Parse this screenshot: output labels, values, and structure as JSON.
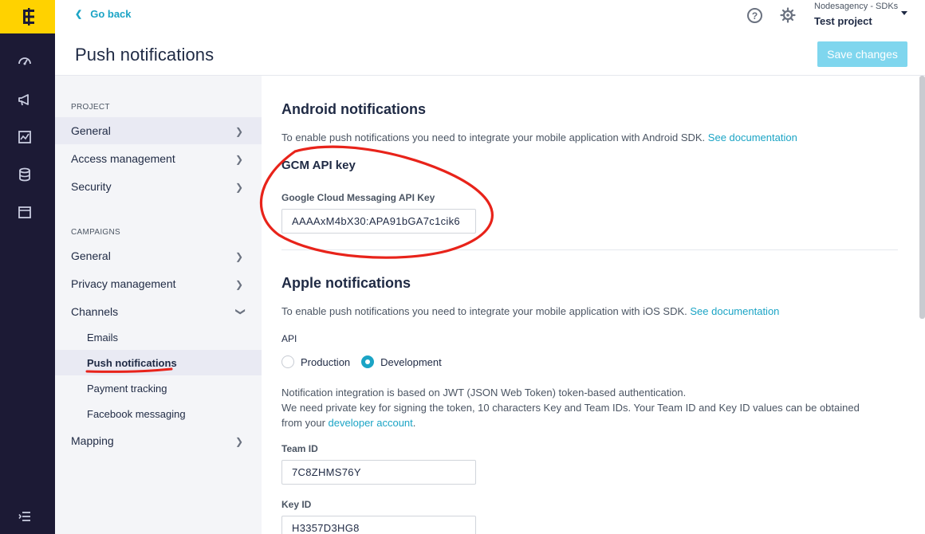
{
  "header": {
    "go_back": "Go back",
    "title": "Push notifications",
    "org_name": "Nodesagency - SDKs",
    "project_name": "Test project",
    "save_label": "Save changes"
  },
  "rail": {
    "logo": "Ɇ",
    "icons": [
      "dashboard-icon",
      "megaphone-icon",
      "analytics-icon",
      "database-icon",
      "folder-icon",
      "collapse-menu-icon"
    ]
  },
  "nav": {
    "project_section": "PROJECT",
    "project_items": [
      "General",
      "Access management",
      "Security"
    ],
    "campaigns_section": "CAMPAIGNS",
    "campaign_items": [
      "General",
      "Privacy management",
      "Channels"
    ],
    "channel_items": [
      "Emails",
      "Push notifications",
      "Payment tracking",
      "Facebook messaging"
    ],
    "mapping": "Mapping"
  },
  "android": {
    "title": "Android notifications",
    "desc": "To enable push notifications you need to integrate your mobile application with Android SDK.",
    "doc_link": "See documentation",
    "gcm_title": "GCM API key",
    "gcm_label": "Google Cloud Messaging API Key",
    "gcm_value": "AAAAxM4bX30:APA91bGA7c1cik6"
  },
  "apple": {
    "title": "Apple notifications",
    "desc": "To enable push notifications you need to integrate your mobile application with iOS SDK.",
    "doc_link": "See documentation",
    "api_label": "API",
    "api_options": [
      "Production",
      "Development"
    ],
    "api_selected": "Development",
    "info_line1": "Notification integration is based on JWT (JSON Web Token) token-based authentication.",
    "info_line2": "We need private key for signing the token, 10 characters Key and Team IDs. Your Team ID and Key ID values can be obtained",
    "info_line3_pre": "from your",
    "info_link": "developer account",
    "info_line3_post": ".",
    "team_id_label": "Team ID",
    "team_id_value": "7C8ZHMS76Y",
    "key_id_label": "Key ID",
    "key_id_value": "H3357D3HG8"
  },
  "colors": {
    "accent": "#1ba4c5",
    "brand_yellow": "#ffd200",
    "rail_bg": "#1c1a35",
    "annotation_red": "#e8231a"
  }
}
